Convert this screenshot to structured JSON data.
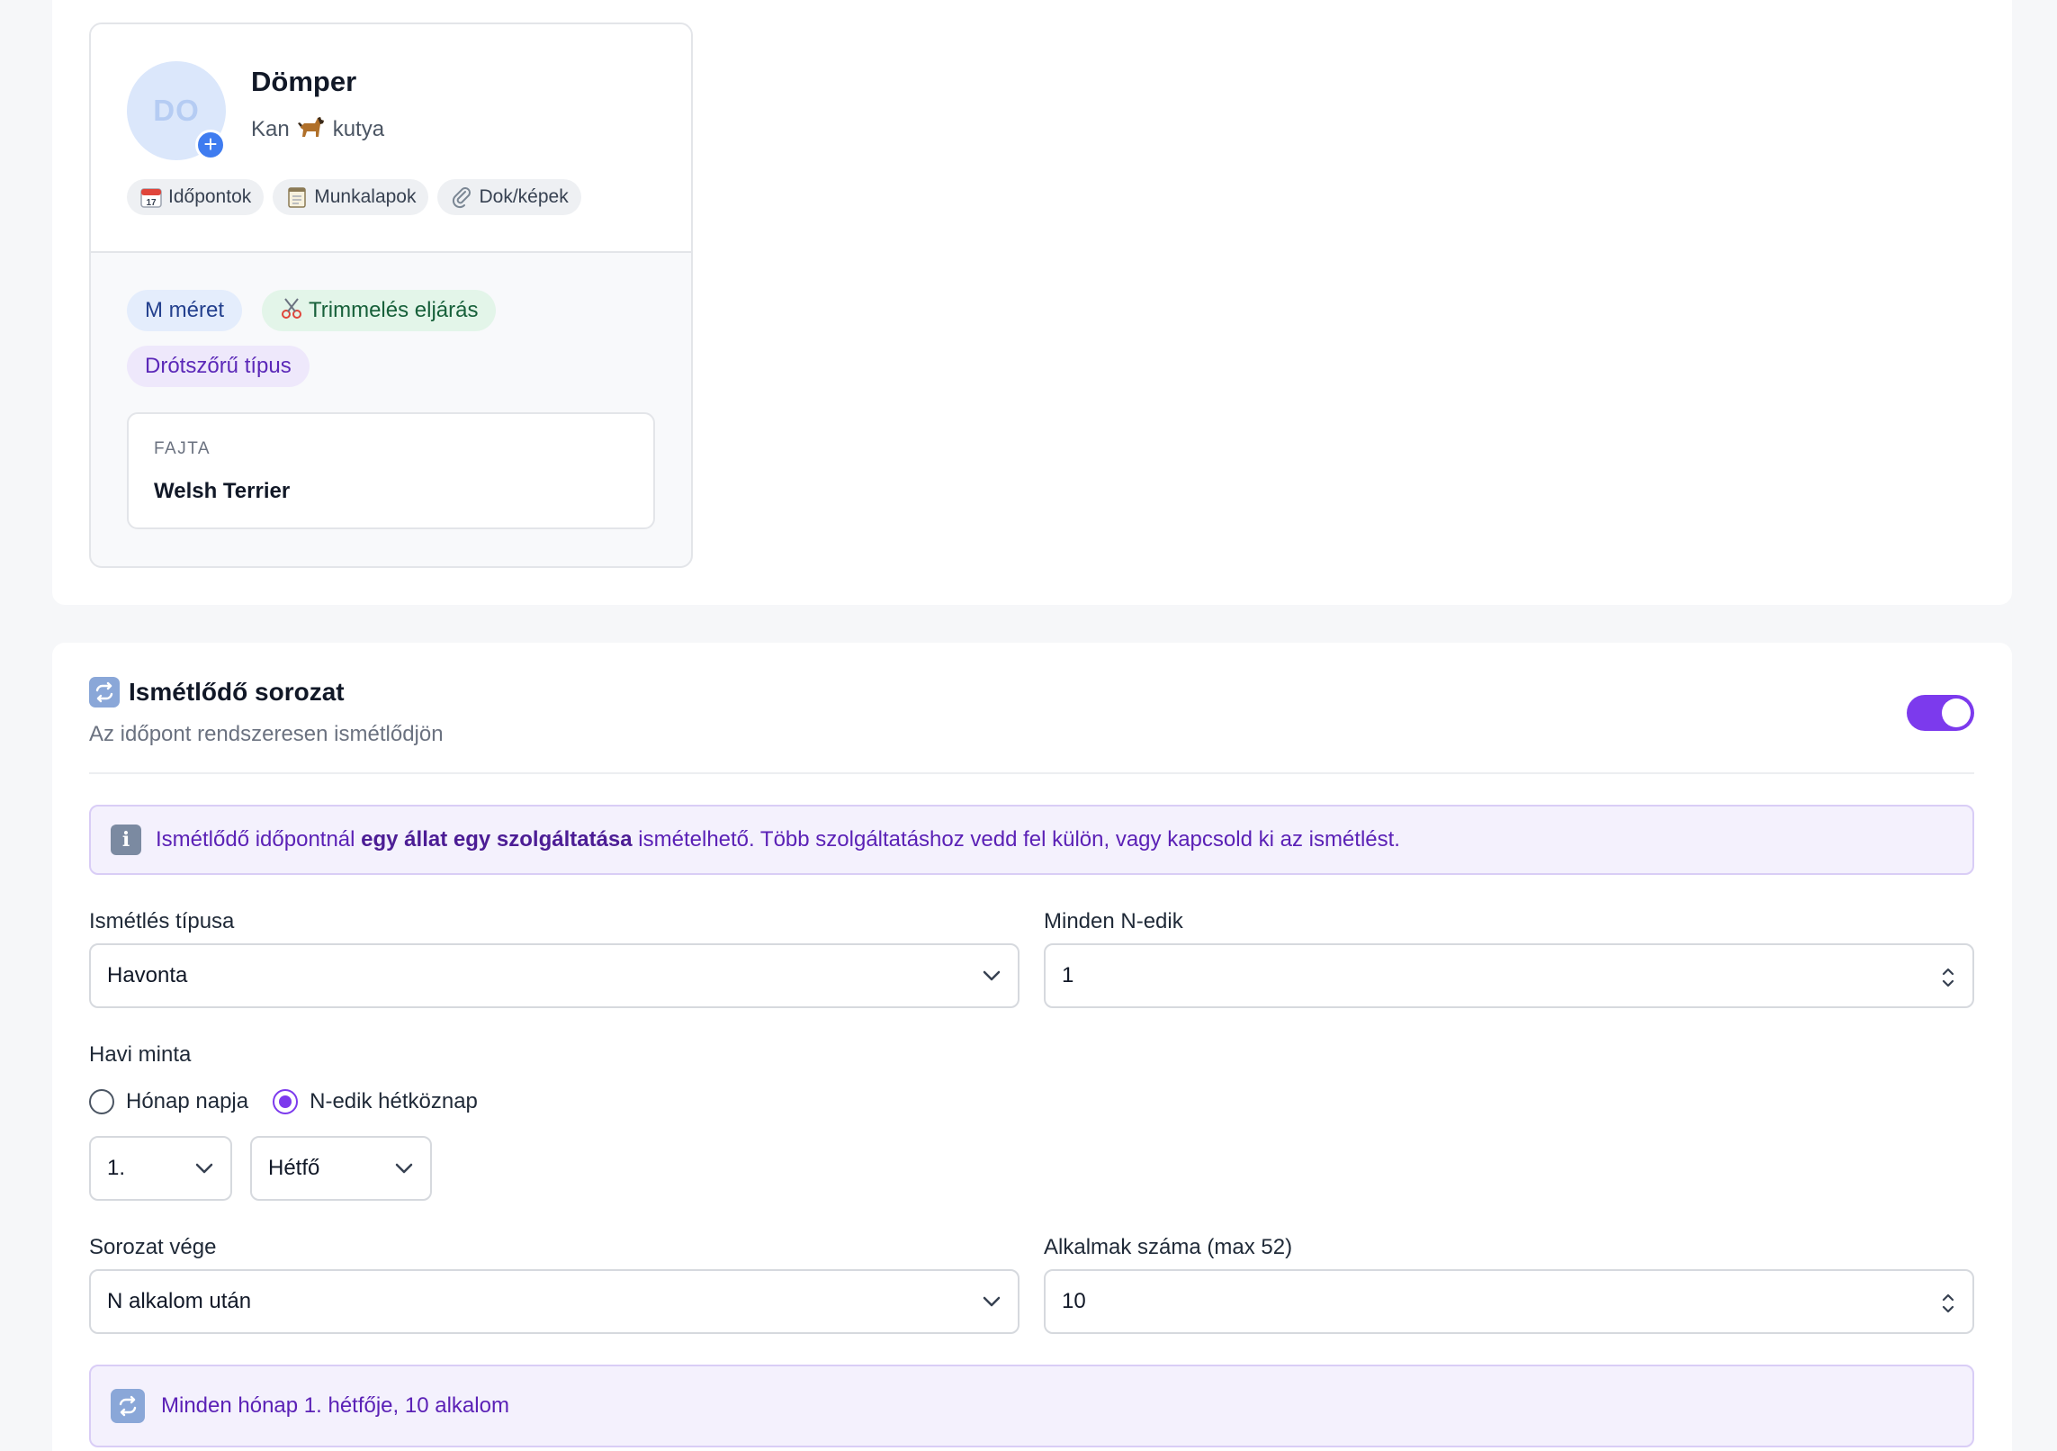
{
  "pet": {
    "initials": "DO",
    "name": "Dömper",
    "sex": "Kan",
    "species_icon": "dog-icon",
    "species": "kutya",
    "quick_links": [
      {
        "icon": "calendar-icon",
        "label": "Időpontok"
      },
      {
        "icon": "notepad-icon",
        "label": "Munkalapok"
      },
      {
        "icon": "paperclip-icon",
        "label": "Dok/képek"
      }
    ],
    "tags": {
      "size": "M méret",
      "procedure_icon": "scissors-icon",
      "procedure": "Trimmelés eljárás",
      "coat_type": "Drótszőrű típus"
    },
    "breed": {
      "label": "FAJTA",
      "value": "Welsh Terrier"
    }
  },
  "recurring": {
    "title_icon": "repeat-icon",
    "title": "Ismétlődő sorozat",
    "subtitle": "Az időpont rendszeresen ismétlődjön",
    "enabled": true,
    "info": {
      "icon": "info-icon",
      "text_before": "Ismétlődő időpontnál ",
      "text_bold": "egy állat egy szolgáltatása",
      "text_after": " ismételhető. Több szolgáltatáshoz vedd fel külön, vagy kapcsold ki az ismétlést."
    },
    "repeat_type": {
      "label": "Ismétlés típusa",
      "value": "Havonta"
    },
    "every_n": {
      "label": "Minden N-edik",
      "value": "1"
    },
    "monthly_pattern": {
      "label": "Havi minta",
      "options": [
        "Hónap napja",
        "N-edik hétköznap"
      ],
      "selected": "N-edik hétköznap",
      "ordinal": "1.",
      "weekday": "Hétfő"
    },
    "series_end": {
      "label": "Sorozat vége",
      "value": "N alkalom után"
    },
    "occurrences": {
      "label": "Alkalmak száma (max 52)",
      "value": "10"
    },
    "summary": "Minden hónap 1. hétfője, 10 alkalom"
  },
  "colors": {
    "accent": "#7c3aed",
    "avatar_badge": "#3f7cf0"
  }
}
